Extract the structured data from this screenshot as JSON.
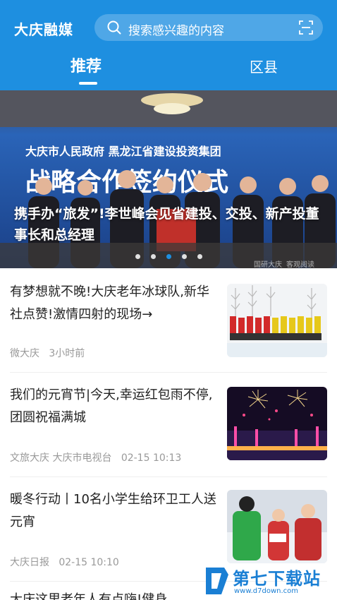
{
  "header": {
    "logo": "大庆融媒",
    "search_placeholder": "搜索感兴趣的内容",
    "tabs": [
      {
        "label": "推荐",
        "active": true
      },
      {
        "label": "区县",
        "active": false
      }
    ],
    "accent_color": "#1e8fe0"
  },
  "banner": {
    "backdrop_line1": "大庆市人民政府  黑龙江省建设投资集团",
    "backdrop_line2": "战略合作签约仪式",
    "caption": "携手办“旅发”!李世峰会见省建投、交投、新产投董事长和总经理",
    "dots_count": 5,
    "active_dot": 2,
    "sign_text_1": "国研大庆",
    "sign_text_2": "客观阅读"
  },
  "news": [
    {
      "title": "有梦想就不晚!大庆老年冰球队,新华社点赞!激情四射的现场→",
      "source": "微大庆",
      "time": "3小时前",
      "thumb": "ice-hockey-team-photo"
    },
    {
      "title": "我们的元宵节|今天,幸运红包雨不停,团圆祝福满城",
      "source": "文旅大庆 大庆市电视台",
      "time": "02-15 10:13",
      "thumb": "fireworks-night-photo"
    },
    {
      "title": "暖冬行动丨10名小学生给环卫工人送元宵",
      "source": "大庆日报",
      "time": "02-15 10:10",
      "thumb": "students-sanitation-workers-photo"
    },
    {
      "title": "大庆这里老年人有点嗨!健身",
      "source": "",
      "time": "",
      "thumb": ""
    }
  ],
  "watermark": {
    "text": "第七下载站",
    "url": "www.d7down.com"
  }
}
